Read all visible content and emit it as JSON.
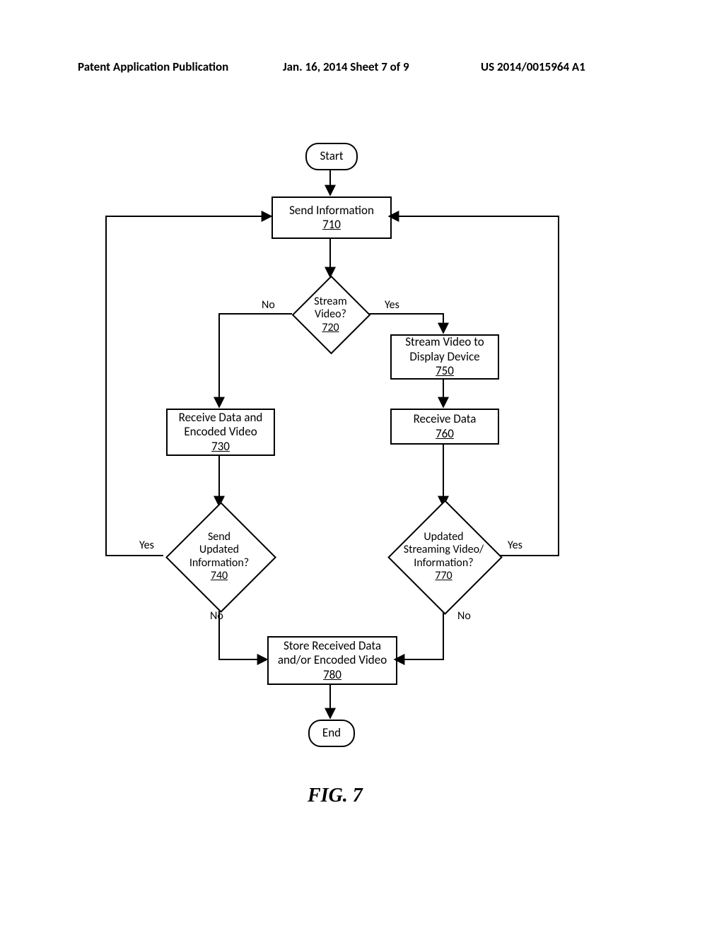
{
  "header": {
    "left": "Patent Application Publication",
    "center": "Jan. 16, 2014  Sheet 7 of 9",
    "right": "US 2014/0015964 A1"
  },
  "figure_label": "FIG. 7",
  "nodes": {
    "start": {
      "label": "Start"
    },
    "n710": {
      "label": "Send Information",
      "ref": "710"
    },
    "n720": {
      "label": "Stream\nVideo?",
      "ref": "720"
    },
    "n730": {
      "label": "Receive Data and\nEncoded Video",
      "ref": "730"
    },
    "n740": {
      "label": "Send\nUpdated\nInformation?",
      "ref": "740"
    },
    "n750": {
      "label": "Stream Video to\nDisplay Device",
      "ref": "750"
    },
    "n760": {
      "label": "Receive Data",
      "ref": "760"
    },
    "n770": {
      "label": "Updated\nStreaming Video/\nInformation?",
      "ref": "770"
    },
    "n780": {
      "label": "Store Received Data\nand/or Encoded Video",
      "ref": "780"
    },
    "end": {
      "label": "End"
    }
  },
  "edge_labels": {
    "n720_no": "No",
    "n720_yes": "Yes",
    "n740_yes": "Yes",
    "n740_no": "No",
    "n770_yes": "Yes",
    "n770_no": "No"
  }
}
